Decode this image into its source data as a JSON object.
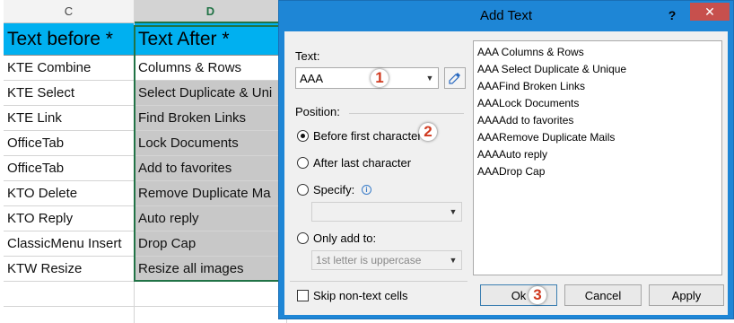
{
  "sheet": {
    "columns": {
      "c": "C",
      "d": "D"
    },
    "header": {
      "c": "Text before *",
      "d": "Text After *"
    },
    "rows": [
      {
        "c": "KTE Combine",
        "d": "Columns & Rows"
      },
      {
        "c": "KTE Select",
        "d": "Select Duplicate & Uni"
      },
      {
        "c": "KTE Link",
        "d": "Find Broken Links"
      },
      {
        "c": "OfficeTab",
        "d": "Lock Documents"
      },
      {
        "c": "OfficeTab",
        "d": "Add to favorites"
      },
      {
        "c": "KTO Delete",
        "d": "Remove Duplicate Ma"
      },
      {
        "c": "KTO Reply",
        "d": "Auto reply"
      },
      {
        "c": "ClassicMenu Insert",
        "d": "Drop Cap"
      },
      {
        "c": "KTW Resize",
        "d": "Resize all images"
      }
    ]
  },
  "dialog": {
    "title": "Add Text",
    "help": "?",
    "close": "✕",
    "text_label": "Text:",
    "text_value": "AAA",
    "position_label": "Position:",
    "options": {
      "before_first": "Before first character",
      "after_last": "After last character",
      "specify": "Specify:",
      "only_add_to": "Only add to:"
    },
    "specify_value": "",
    "only_add_value": "1st letter is uppercase",
    "skip_label": "Skip non-text cells",
    "preview": [
      "AAA Columns & Rows",
      "AAA Select Duplicate & Unique",
      "AAAFind Broken Links",
      "AAALock Documents",
      "AAAAdd to favorites",
      "AAARemove Duplicate Mails",
      "AAAAuto reply",
      "AAADrop Cap"
    ],
    "buttons": {
      "ok": "Ok",
      "cancel": "Cancel",
      "apply": "Apply"
    },
    "steps": {
      "one": "1",
      "two": "2",
      "three": "3"
    }
  },
  "colors": {
    "header_fill": "#00b0f0",
    "selection": "#217346",
    "dialog_frame": "#1e86d6",
    "close": "#c7504d",
    "badge": "#d03a20"
  }
}
